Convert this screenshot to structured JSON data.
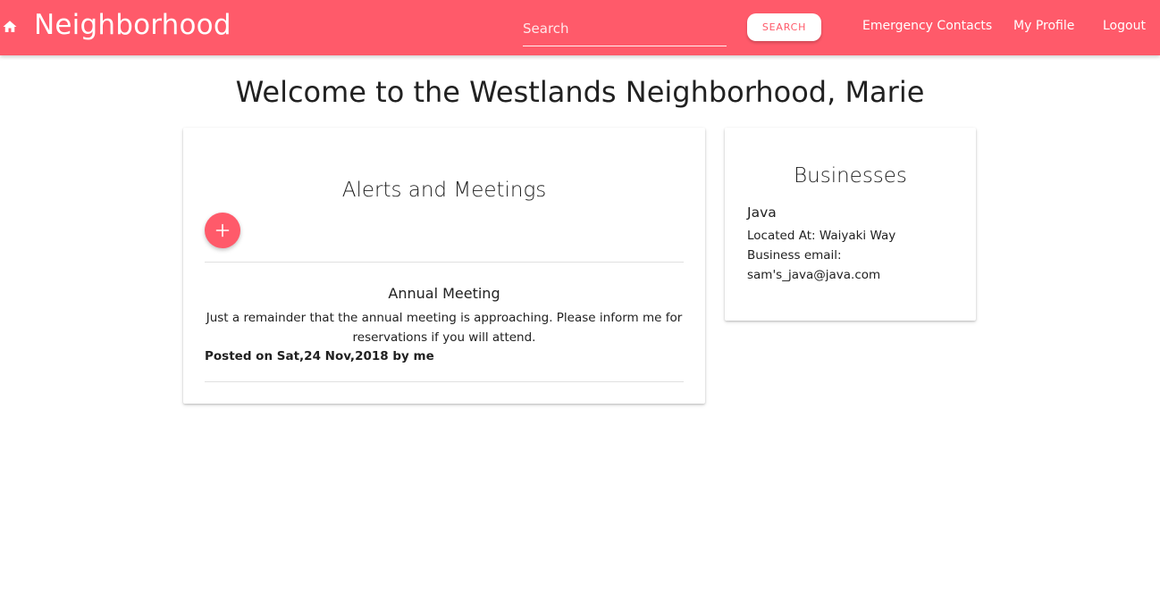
{
  "navbar": {
    "brand": "Neighborhood",
    "home_icon": "home-icon",
    "search": {
      "placeholder": "Search",
      "value": ""
    },
    "search_button": "SEARCH",
    "links": [
      "Emergency Contacts",
      "My Profile",
      "Logout"
    ]
  },
  "main": {
    "welcome": "Welcome to the Westlands Neighborhood, Marie"
  },
  "alerts": {
    "title": "Alerts and Meetings",
    "add_icon": "plus-icon",
    "items": [
      {
        "title": "Annual Meeting",
        "body": "Just a remainder that the annual meeting is approaching. Please inform me for reservations if you will attend.",
        "posted": "Posted on Sat,24 Nov,2018 by me"
      }
    ]
  },
  "businesses": {
    "title": "Businesses",
    "items": [
      {
        "name": "Java",
        "location": "Located At: Waiyaki Way",
        "email_label": "Business email:",
        "email": "sam's_java@java.com"
      }
    ]
  },
  "colors": {
    "primary": "#ff5a6a",
    "surface": "#ffffff",
    "text": "#212121",
    "divider": "#e0e0e0"
  }
}
